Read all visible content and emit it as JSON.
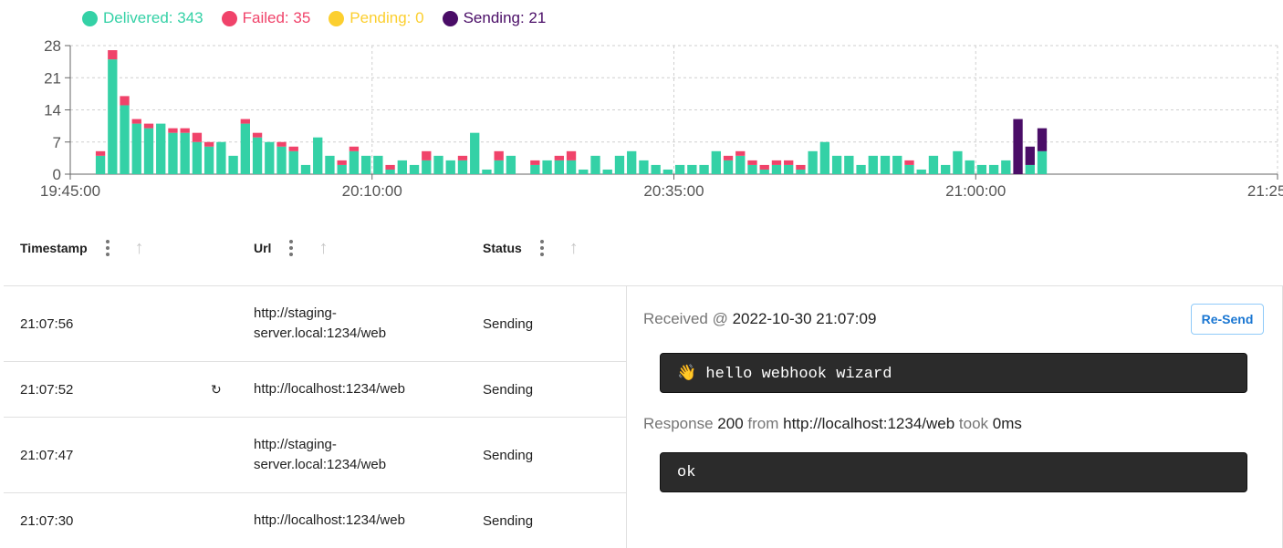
{
  "legend": [
    {
      "label": "Delivered: 343",
      "color": "#34d1a6"
    },
    {
      "label": "Failed: 35",
      "color": "#f0436a"
    },
    {
      "label": "Pending: 0",
      "color": "#fccf2f"
    },
    {
      "label": "Sending: 21",
      "color": "#4a0d67"
    }
  ],
  "colors": {
    "delivered": "#34d1a6",
    "failed": "#f0436a",
    "pending": "#fccf2f",
    "sending": "#4a0d67"
  },
  "chart_data": {
    "type": "bar",
    "stacked": true,
    "x_tick_labels": [
      "19:45:00",
      "20:10:00",
      "20:35:00",
      "21:00:00",
      "21:25:00"
    ],
    "x_range_minutes": [
      0,
      100
    ],
    "y_ticks": [
      0,
      7,
      14,
      21,
      28
    ],
    "ylim": [
      0,
      28
    ],
    "grid": "dashed",
    "series_keys": [
      "delivered",
      "failed",
      "sending"
    ],
    "bars": [
      {
        "t": 2.5,
        "delivered": 4,
        "failed": 1,
        "sending": 0
      },
      {
        "t": 3.5,
        "delivered": 25,
        "failed": 2,
        "sending": 0
      },
      {
        "t": 4.5,
        "delivered": 15,
        "failed": 2,
        "sending": 0
      },
      {
        "t": 5.5,
        "delivered": 11,
        "failed": 1,
        "sending": 0
      },
      {
        "t": 6.5,
        "delivered": 10,
        "failed": 1,
        "sending": 0
      },
      {
        "t": 7.5,
        "delivered": 11,
        "failed": 0,
        "sending": 0
      },
      {
        "t": 8.5,
        "delivered": 9,
        "failed": 1,
        "sending": 0
      },
      {
        "t": 9.5,
        "delivered": 9,
        "failed": 1,
        "sending": 0
      },
      {
        "t": 10.5,
        "delivered": 7,
        "failed": 2,
        "sending": 0
      },
      {
        "t": 11.5,
        "delivered": 6,
        "failed": 1,
        "sending": 0
      },
      {
        "t": 12.5,
        "delivered": 7,
        "failed": 0,
        "sending": 0
      },
      {
        "t": 13.5,
        "delivered": 4,
        "failed": 0,
        "sending": 0
      },
      {
        "t": 14.5,
        "delivered": 11,
        "failed": 1,
        "sending": 0
      },
      {
        "t": 15.5,
        "delivered": 8,
        "failed": 1,
        "sending": 0
      },
      {
        "t": 16.5,
        "delivered": 7,
        "failed": 0,
        "sending": 0
      },
      {
        "t": 17.5,
        "delivered": 6,
        "failed": 1,
        "sending": 0
      },
      {
        "t": 18.5,
        "delivered": 5,
        "failed": 1,
        "sending": 0
      },
      {
        "t": 19.5,
        "delivered": 2,
        "failed": 0,
        "sending": 0
      },
      {
        "t": 20.5,
        "delivered": 8,
        "failed": 0,
        "sending": 0
      },
      {
        "t": 21.5,
        "delivered": 4,
        "failed": 0,
        "sending": 0
      },
      {
        "t": 22.5,
        "delivered": 2,
        "failed": 1,
        "sending": 0
      },
      {
        "t": 23.5,
        "delivered": 5,
        "failed": 1,
        "sending": 0
      },
      {
        "t": 24.5,
        "delivered": 4,
        "failed": 0,
        "sending": 0
      },
      {
        "t": 25.5,
        "delivered": 4,
        "failed": 0,
        "sending": 0
      },
      {
        "t": 26.5,
        "delivered": 1,
        "failed": 1,
        "sending": 0
      },
      {
        "t": 27.5,
        "delivered": 3,
        "failed": 0,
        "sending": 0
      },
      {
        "t": 28.5,
        "delivered": 2,
        "failed": 0,
        "sending": 0
      },
      {
        "t": 29.5,
        "delivered": 3,
        "failed": 2,
        "sending": 0
      },
      {
        "t": 30.5,
        "delivered": 4,
        "failed": 0,
        "sending": 0
      },
      {
        "t": 31.5,
        "delivered": 3,
        "failed": 0,
        "sending": 0
      },
      {
        "t": 32.5,
        "delivered": 3,
        "failed": 1,
        "sending": 0
      },
      {
        "t": 33.5,
        "delivered": 9,
        "failed": 0,
        "sending": 0
      },
      {
        "t": 34.5,
        "delivered": 1,
        "failed": 0,
        "sending": 0
      },
      {
        "t": 35.5,
        "delivered": 3,
        "failed": 2,
        "sending": 0
      },
      {
        "t": 36.5,
        "delivered": 4,
        "failed": 0,
        "sending": 0
      },
      {
        "t": 38.5,
        "delivered": 2,
        "failed": 1,
        "sending": 0
      },
      {
        "t": 39.5,
        "delivered": 3,
        "failed": 0,
        "sending": 0
      },
      {
        "t": 40.5,
        "delivered": 3,
        "failed": 1,
        "sending": 0
      },
      {
        "t": 41.5,
        "delivered": 3,
        "failed": 2,
        "sending": 0
      },
      {
        "t": 42.5,
        "delivered": 1,
        "failed": 0,
        "sending": 0
      },
      {
        "t": 43.5,
        "delivered": 4,
        "failed": 0,
        "sending": 0
      },
      {
        "t": 44.5,
        "delivered": 1,
        "failed": 0,
        "sending": 0
      },
      {
        "t": 45.5,
        "delivered": 4,
        "failed": 0,
        "sending": 0
      },
      {
        "t": 46.5,
        "delivered": 5,
        "failed": 0,
        "sending": 0
      },
      {
        "t": 47.5,
        "delivered": 3,
        "failed": 0,
        "sending": 0
      },
      {
        "t": 48.5,
        "delivered": 2,
        "failed": 0,
        "sending": 0
      },
      {
        "t": 49.5,
        "delivered": 1,
        "failed": 0,
        "sending": 0
      },
      {
        "t": 50.5,
        "delivered": 2,
        "failed": 0,
        "sending": 0
      },
      {
        "t": 51.5,
        "delivered": 2,
        "failed": 0,
        "sending": 0
      },
      {
        "t": 52.5,
        "delivered": 2,
        "failed": 0,
        "sending": 0
      },
      {
        "t": 53.5,
        "delivered": 5,
        "failed": 0,
        "sending": 0
      },
      {
        "t": 54.5,
        "delivered": 3,
        "failed": 1,
        "sending": 0
      },
      {
        "t": 55.5,
        "delivered": 4,
        "failed": 1,
        "sending": 0
      },
      {
        "t": 56.5,
        "delivered": 2,
        "failed": 1,
        "sending": 0
      },
      {
        "t": 57.5,
        "delivered": 1,
        "failed": 1,
        "sending": 0
      },
      {
        "t": 58.5,
        "delivered": 2,
        "failed": 1,
        "sending": 0
      },
      {
        "t": 59.5,
        "delivered": 2,
        "failed": 1,
        "sending": 0
      },
      {
        "t": 60.5,
        "delivered": 1,
        "failed": 1,
        "sending": 0
      },
      {
        "t": 61.5,
        "delivered": 5,
        "failed": 0,
        "sending": 0
      },
      {
        "t": 62.5,
        "delivered": 7,
        "failed": 0,
        "sending": 0
      },
      {
        "t": 63.5,
        "delivered": 4,
        "failed": 0,
        "sending": 0
      },
      {
        "t": 64.5,
        "delivered": 4,
        "failed": 0,
        "sending": 0
      },
      {
        "t": 65.5,
        "delivered": 2,
        "failed": 0,
        "sending": 0
      },
      {
        "t": 66.5,
        "delivered": 4,
        "failed": 0,
        "sending": 0
      },
      {
        "t": 67.5,
        "delivered": 4,
        "failed": 0,
        "sending": 0
      },
      {
        "t": 68.5,
        "delivered": 4,
        "failed": 0,
        "sending": 0
      },
      {
        "t": 69.5,
        "delivered": 2,
        "failed": 1,
        "sending": 0
      },
      {
        "t": 70.5,
        "delivered": 1,
        "failed": 0,
        "sending": 0
      },
      {
        "t": 71.5,
        "delivered": 4,
        "failed": 0,
        "sending": 0
      },
      {
        "t": 72.5,
        "delivered": 2,
        "failed": 0,
        "sending": 0
      },
      {
        "t": 73.5,
        "delivered": 5,
        "failed": 0,
        "sending": 0
      },
      {
        "t": 74.5,
        "delivered": 3,
        "failed": 0,
        "sending": 0
      },
      {
        "t": 75.5,
        "delivered": 2,
        "failed": 0,
        "sending": 0
      },
      {
        "t": 76.5,
        "delivered": 2,
        "failed": 0,
        "sending": 0
      },
      {
        "t": 77.5,
        "delivered": 3,
        "failed": 0,
        "sending": 0
      },
      {
        "t": 78.5,
        "delivered": 0,
        "failed": 0,
        "sending": 12
      },
      {
        "t": 79.5,
        "delivered": 2,
        "failed": 0,
        "sending": 4
      },
      {
        "t": 80.5,
        "delivered": 5,
        "failed": 0,
        "sending": 5
      }
    ]
  },
  "columns": [
    {
      "label": "Timestamp"
    },
    {
      "label": "Url"
    },
    {
      "label": "Status"
    }
  ],
  "rows": [
    {
      "timestamp": "21:07:56",
      "resend_mark": "",
      "url": "http://staging-server.local:1234/web",
      "status": "Sending"
    },
    {
      "timestamp": "21:07:52",
      "resend_mark": "↻",
      "url": "http://localhost:1234/web",
      "status": "Sending"
    },
    {
      "timestamp": "21:07:47",
      "resend_mark": "",
      "url": "http://staging-server.local:1234/web",
      "status": "Sending"
    },
    {
      "timestamp": "21:07:30",
      "resend_mark": "",
      "url": "http://localhost:1234/web",
      "status": "Sending"
    }
  ],
  "detail": {
    "received_label": "Received @ ",
    "received_value": "2022-10-30 21:07:09",
    "resend_button": "Re-Send",
    "request_body": "👋 hello webhook wizard",
    "response_label": "Response ",
    "response_code": "200",
    "response_from": " from ",
    "response_url": "http://localhost:1234/web",
    "response_took": " took ",
    "response_time": "0ms",
    "response_body": "ok"
  }
}
